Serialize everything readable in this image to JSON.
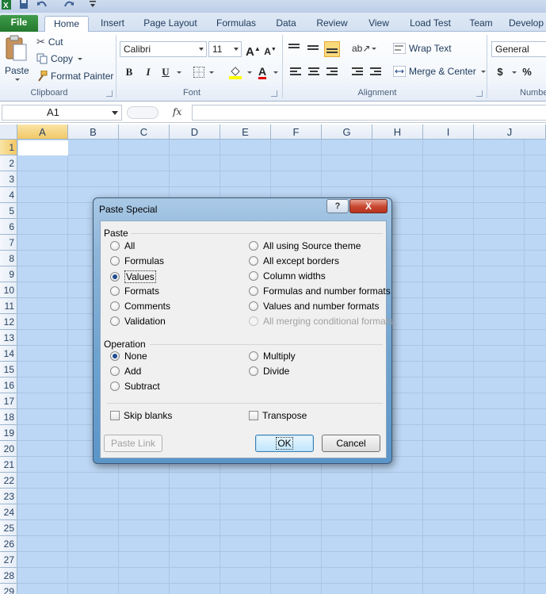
{
  "tabs": {
    "file": "File",
    "home": "Home",
    "insert": "Insert",
    "page_layout": "Page Layout",
    "formulas": "Formulas",
    "data": "Data",
    "review": "Review",
    "view": "View",
    "load_test": "Load Test",
    "team": "Team",
    "developer": "Develop"
  },
  "ribbon": {
    "clipboard": {
      "paste": "Paste",
      "cut": "Cut",
      "copy": "Copy",
      "format_painter": "Format Painter",
      "label": "Clipboard"
    },
    "font": {
      "font_name": "Calibri",
      "font_size": "11",
      "bold": "B",
      "italic": "I",
      "underline": "U",
      "label": "Font"
    },
    "alignment": {
      "wrap_text": "Wrap Text",
      "merge_center": "Merge & Center",
      "label": "Alignment"
    },
    "number": {
      "format": "General",
      "currency": "$",
      "percent": "%",
      "label": "Numbe"
    }
  },
  "formula_bar": {
    "name_box": "A1",
    "fx": "fx",
    "formula": ""
  },
  "grid": {
    "columns": [
      "A",
      "B",
      "C",
      "D",
      "E",
      "F",
      "G",
      "H",
      "I",
      "J"
    ],
    "rows": [
      "1",
      "2",
      "3",
      "4",
      "5",
      "6",
      "7",
      "8",
      "9",
      "10",
      "11",
      "12",
      "13",
      "14",
      "15",
      "16",
      "17",
      "18",
      "19",
      "20",
      "21",
      "22",
      "23",
      "24",
      "25",
      "26",
      "27",
      "28",
      "29"
    ]
  },
  "dialog": {
    "title": "Paste Special",
    "help": "?",
    "close": "X",
    "paste_section": "Paste",
    "paste_left": [
      {
        "label": "All",
        "selected": false
      },
      {
        "label": "Formulas",
        "selected": false
      },
      {
        "label": "Values",
        "selected": true
      },
      {
        "label": "Formats",
        "selected": false
      },
      {
        "label": "Comments",
        "selected": false
      },
      {
        "label": "Validation",
        "selected": false
      }
    ],
    "paste_right": [
      {
        "label": "All using Source theme",
        "selected": false,
        "disabled": false
      },
      {
        "label": "All except borders",
        "selected": false,
        "disabled": false
      },
      {
        "label": "Column widths",
        "selected": false,
        "disabled": false
      },
      {
        "label": "Formulas and number formats",
        "selected": false,
        "disabled": false
      },
      {
        "label": "Values and number formats",
        "selected": false,
        "disabled": false
      },
      {
        "label": "All merging conditional formats",
        "selected": false,
        "disabled": true
      }
    ],
    "operation_section": "Operation",
    "operation_left": [
      {
        "label": "None",
        "selected": true
      },
      {
        "label": "Add",
        "selected": false
      },
      {
        "label": "Subtract",
        "selected": false
      }
    ],
    "operation_right": [
      {
        "label": "Multiply",
        "selected": false
      },
      {
        "label": "Divide",
        "selected": false
      }
    ],
    "skip_blanks": "Skip blanks",
    "transpose": "Transpose",
    "paste_link": "Paste Link",
    "ok": "OK",
    "cancel": "Cancel"
  },
  "colors": {
    "file_tab": "#2e8b3a",
    "selection": "#bcd7f5",
    "dialog_frame": "#6ea3cf"
  }
}
